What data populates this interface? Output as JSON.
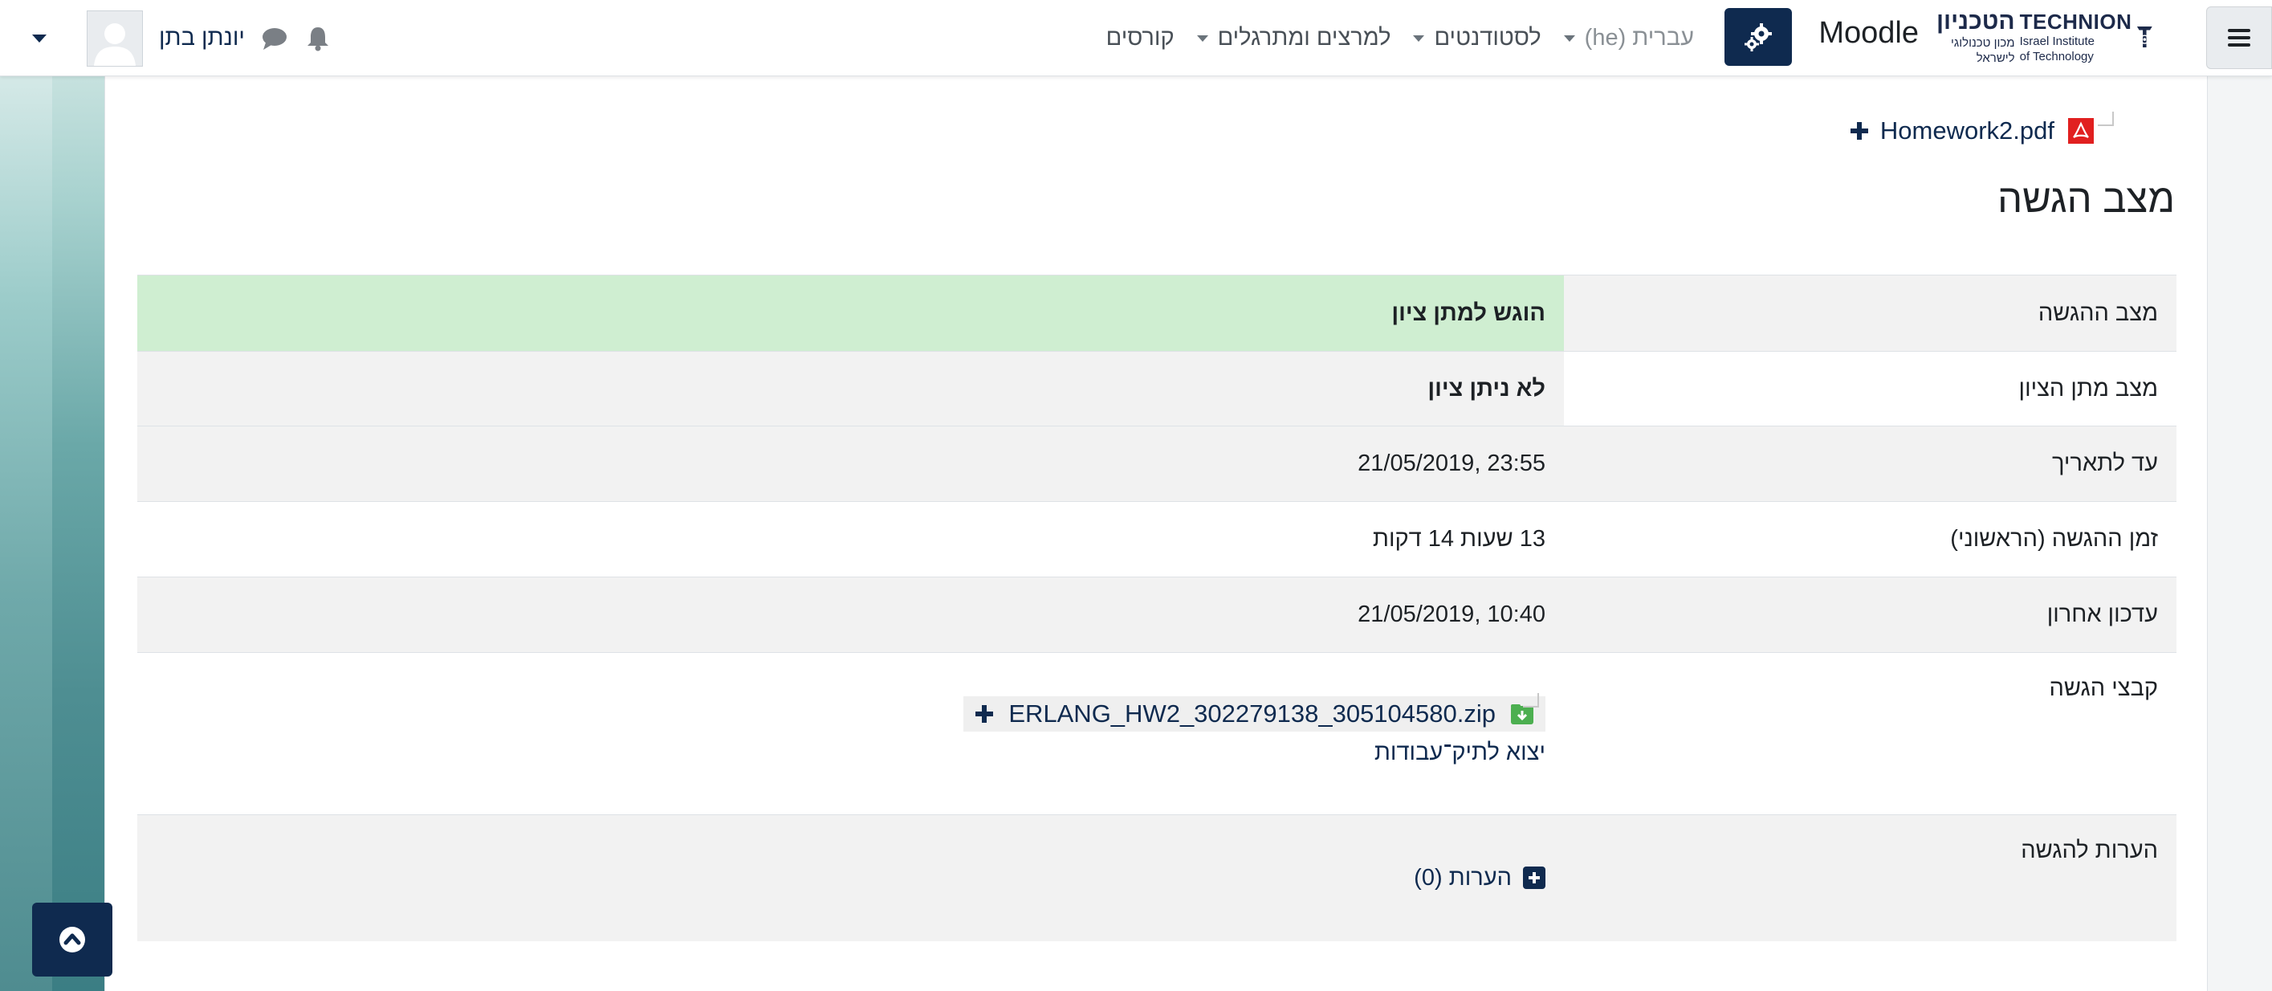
{
  "navbar": {
    "brand": "Moodle",
    "logo_en_line1": "TECHNION",
    "logo_en_line2": "Israel Institute",
    "logo_en_line3": "of Technology",
    "logo_he_line1": "הטכניון",
    "logo_he_line2": "מכון טכנולוגי",
    "logo_he_line3": "לישראל",
    "items": [
      {
        "label": "קורסים",
        "has_caret": false
      },
      {
        "label": "למרצים ומתרגלים",
        "has_caret": true
      },
      {
        "label": "לסטודנטים",
        "has_caret": true
      },
      {
        "label": "עברית (he)",
        "has_caret": true
      }
    ],
    "user_name": "יונתן בתן",
    "icons": [
      "hamburger-icon",
      "gears-icon",
      "bell-icon",
      "chat-icon",
      "chevron-down-icon"
    ]
  },
  "attachment": {
    "file_name": "Homework2.pdf"
  },
  "section_title": "מצב הגשה",
  "status_table": {
    "rows": [
      {
        "label": "מצב ההגשה",
        "value": "הוגש למתן ציון"
      },
      {
        "label": "מצב מתן הציון",
        "value": "לא ניתן ציון"
      },
      {
        "label": "עד לתאריך",
        "value": "21/05/2019, 23:55"
      },
      {
        "label": "זמן ההגשה (הראשוני)",
        "value": "13 שעות 14 דקות"
      },
      {
        "label": "עדכון אחרון",
        "value": "21/05/2019, 10:40"
      },
      {
        "label": "קבצי הגשה",
        "file": "ERLANG_HW2_302279138_305104580.zip",
        "link": "יצוא לתיק־עבודות"
      },
      {
        "label": "הערות להגשה",
        "comments": "הערות (0)"
      }
    ]
  },
  "colors": {
    "primary": "#0f2a4f",
    "submitted_bg": "#cfeed1",
    "row_alt_bg": "#f2f2f2"
  }
}
